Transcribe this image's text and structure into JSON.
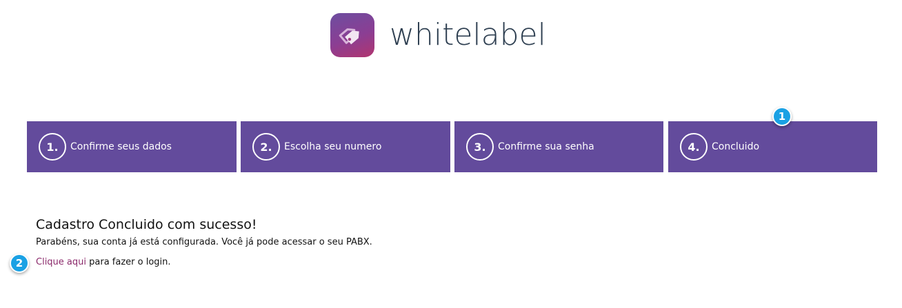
{
  "brand": {
    "name": "whitelabel",
    "logo_icon": "tag-icon"
  },
  "steps": [
    {
      "number": "1.",
      "label": "Confirme seus dados"
    },
    {
      "number": "2.",
      "label": "Escolha seu numero"
    },
    {
      "number": "3.",
      "label": "Confirme sua senha"
    },
    {
      "number": "4.",
      "label": "Concluido"
    }
  ],
  "markers": [
    "1",
    "2"
  ],
  "result": {
    "title": "Cadastro Concluido com sucesso!",
    "message": "Parabéns, sua conta já está configurada. Você já pode acessar o seu PABX.",
    "login_link": "Clique aqui",
    "login_suffix": " para fazer o login."
  },
  "colors": {
    "step_background": "#634b9c",
    "link": "#8b2a6b",
    "marker": "#1aa1e4",
    "logo_text": "#2d3e50"
  }
}
